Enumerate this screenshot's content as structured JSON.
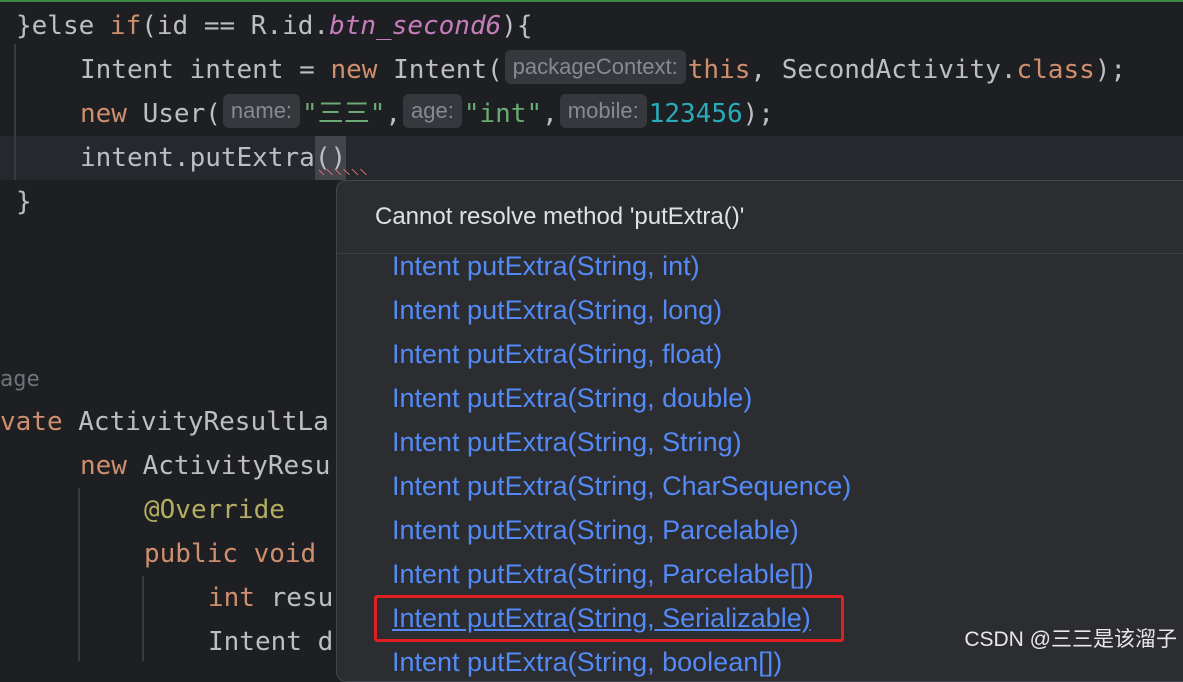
{
  "code": {
    "l1": {
      "a": "}else ",
      "kw_if": "if",
      "b": "(id == R.id.",
      "field": "btn_second6",
      "c": "){"
    },
    "l2": {
      "a": "Intent intent = ",
      "kw_new": "new",
      "b": " Intent(",
      "hint": "packageContext:",
      "kw_this": "this",
      "c": ", SecondActivity.",
      "kw_class": "class",
      "d": ");"
    },
    "l3": {
      "kw_new": "new",
      "a": " User(",
      "hint_name": "name:",
      "s1": "\"三三\"",
      "comma1": ",",
      "hint_age": "age:",
      "s2": "\"int\"",
      "comma2": ",",
      "hint_mobile": "mobile:",
      "n": "123456",
      "b": ");"
    },
    "l4": {
      "a": "intent.putExtra",
      "paren": "()"
    },
    "l5": {
      "a": "}"
    },
    "l6": {
      "a": "age"
    },
    "l7": {
      "kw": "vate",
      "a": " ActivityResultLa"
    },
    "l8": {
      "kw_new": "new",
      "a": " ActivityResu"
    },
    "l9": {
      "ann": "@Override"
    },
    "l10": {
      "kw_public": "public",
      "kw_void": "void"
    },
    "l11": {
      "kw_int": "int",
      "a": " resu"
    },
    "l12": {
      "a": "Intent d"
    }
  },
  "popup": {
    "title": "Cannot resolve method 'putExtra()'",
    "options": [
      "Intent putExtra(String, int)",
      "Intent putExtra(String, long)",
      "Intent putExtra(String, float)",
      "Intent putExtra(String, double)",
      "Intent putExtra(String, String)",
      "Intent putExtra(String, CharSequence)",
      "Intent putExtra(String, Parcelable)",
      "Intent putExtra(String, Parcelable[])",
      "Intent putExtra(String, Serializable)",
      "Intent putExtra(String, boolean[])"
    ],
    "highlighted_option": "Intent putExtra(String, Serializable)"
  },
  "watermark": "CSDN @三三是该溜子",
  "colors": {
    "background": "#1e1f22",
    "keyword": "#cf8e6d",
    "string": "#6aab73",
    "number": "#2aacb8",
    "link": "#548af7",
    "highlight_box": "#e02020"
  }
}
